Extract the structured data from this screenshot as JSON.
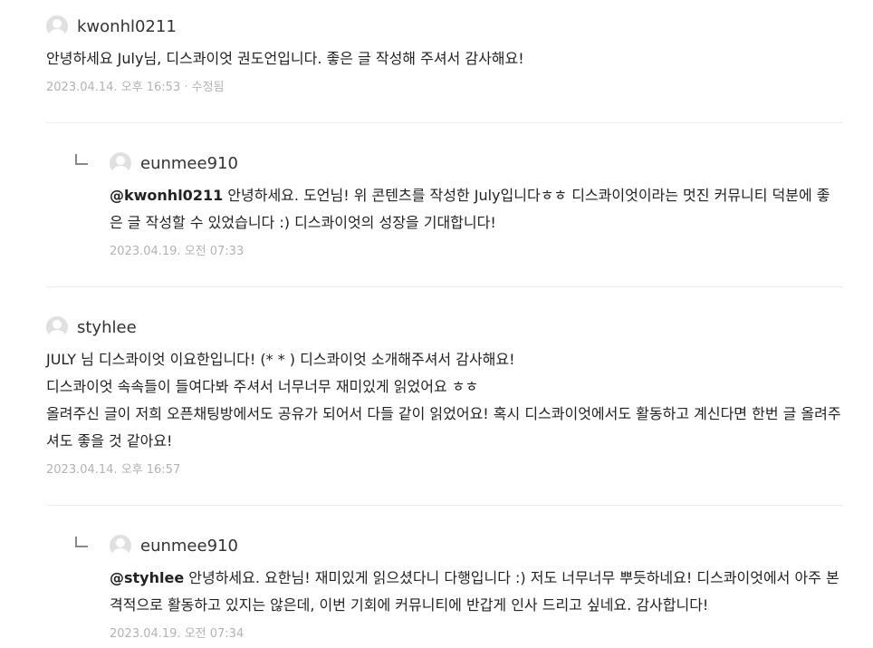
{
  "comments": [
    {
      "author": "kwonhl0211",
      "text": "안녕하세요 July님, 디스콰이엇 권도언입니다. 좋은 글 작성해 주셔서 감사해요!",
      "date": "2023.04.14. 오후 16:53 · 수정됨",
      "reply": {
        "author": "eunmee910",
        "mention": "@kwonhl0211",
        "text": " 안녕하세요. 도언님! 위 콘텐츠를 작성한 July입니다ㅎㅎ 디스콰이엇이라는 멋진 커뮤니티 덕분에 좋은 글 작성할 수 있었습니다 :) 디스콰이엇의 성장을 기대합니다!",
        "date": "2023.04.19. 오전 07:33"
      }
    },
    {
      "author": "styhlee",
      "text": "JULY 님 디스콰이엇 이요한입니다! (* * ) 디스콰이엇 소개해주셔서 감사해요!\n디스콰이엇 속속들이 들여다봐 주셔서 너무너무 재미있게 읽었어요 ㅎㅎ\n올려주신 글이 저희 오픈채팅방에서도 공유가 되어서 다들 같이 읽었어요! 혹시 디스콰이엇에서도 활동하고 계신다면 한번 글 올려주셔도 좋을 것 같아요!",
      "date": "2023.04.14. 오후 16:57",
      "reply": {
        "author": "eunmee910",
        "mention": "@styhlee",
        "text": " 안녕하세요. 요한님! 재미있게 읽으셨다니 다행입니다 :) 저도 너무너무 뿌듯하네요! 디스콰이엇에서 아주 본격적으로 활동하고 있지는 않은데, 이번 기회에 커뮤니티에 반갑게 인사 드리고 싶네요. 감사합니다!",
        "date": "2023.04.19. 오전 07:34"
      }
    }
  ]
}
